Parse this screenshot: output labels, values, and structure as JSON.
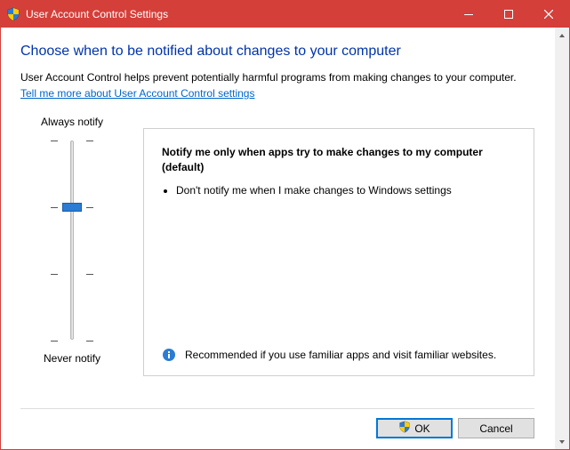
{
  "window": {
    "title": "User Account Control Settings"
  },
  "heading": "Choose when to be notified about changes to your computer",
  "intro": "User Account Control helps prevent potentially harmful programs from making changes to your computer.",
  "help_link": "Tell me more about User Account Control settings",
  "slider": {
    "top_label": "Always notify",
    "bottom_label": "Never notify",
    "level_count": 4,
    "current_level": 2
  },
  "description": {
    "title": "Notify me only when apps try to make changes to my computer (default)",
    "bullet": "Don't notify me when I make changes to Windows settings",
    "recommendation": "Recommended if you use familiar apps and visit familiar websites."
  },
  "buttons": {
    "ok": "OK",
    "cancel": "Cancel"
  }
}
